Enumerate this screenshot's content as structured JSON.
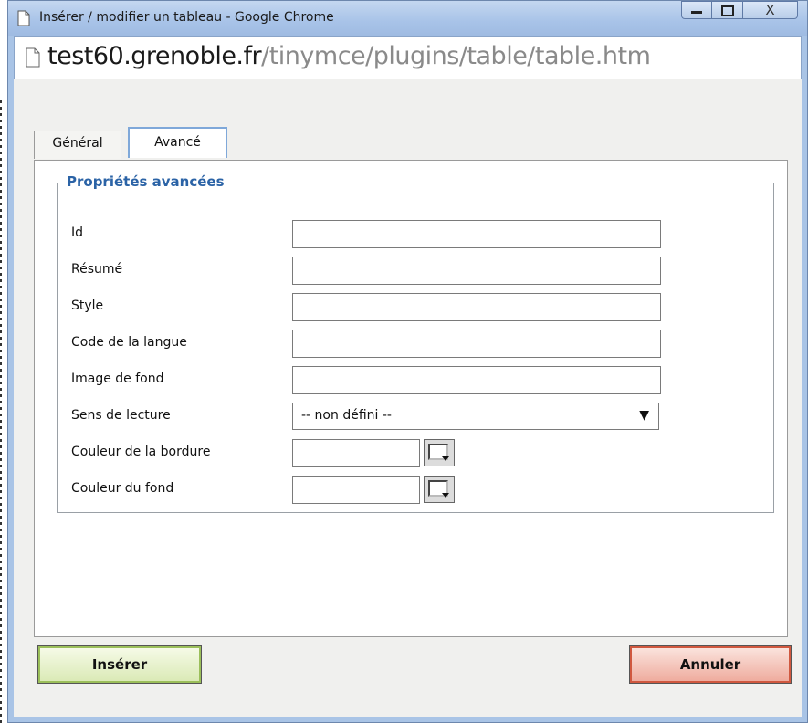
{
  "window": {
    "title": "Insérer / modifier un tableau - Google Chrome",
    "controls": {
      "close_glyph": "X"
    }
  },
  "address": {
    "host": "test60.grenoble.fr",
    "path": "/tinymce/plugins/table/table.htm"
  },
  "tabs": [
    {
      "label": "Général",
      "active": false
    },
    {
      "label": "Avancé",
      "active": true
    }
  ],
  "advanced": {
    "legend": "Propriétés avancées",
    "fields": {
      "id": {
        "label": "Id",
        "value": ""
      },
      "summary": {
        "label": "Résumé",
        "value": ""
      },
      "style": {
        "label": "Style",
        "value": ""
      },
      "lang_code": {
        "label": "Code de la langue",
        "value": ""
      },
      "background_image": {
        "label": "Image de fond",
        "value": ""
      },
      "direction": {
        "label": "Sens de lecture",
        "selected": "-- non défini --"
      },
      "border_color": {
        "label": "Couleur de la bordure",
        "value": ""
      },
      "background_color": {
        "label": "Couleur du fond",
        "value": ""
      }
    }
  },
  "actions": {
    "insert_label": "Insérer",
    "cancel_label": "Annuler"
  },
  "colors": {
    "accent": "#2b63a6",
    "insert_button": "#d9e9b4",
    "cancel_button": "#eea99b"
  }
}
